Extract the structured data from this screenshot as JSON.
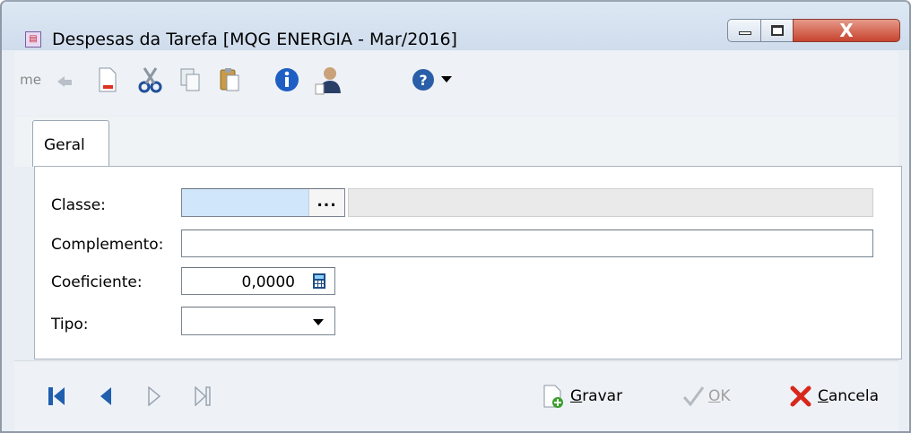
{
  "window": {
    "title": "Despesas da Tarefa [MQG ENERGIA - Mar/2016]",
    "close_glyph": "X"
  },
  "toolbar": {
    "text_fragment": "me",
    "icons": [
      "undo-icon",
      "new-document-icon",
      "cut-icon",
      "copy-icon",
      "paste-icon",
      "info-icon",
      "user-icon",
      "help-icon",
      "dropdown-arrow-icon"
    ]
  },
  "tabs": [
    {
      "label": "Geral",
      "hotkey": "e"
    }
  ],
  "form": {
    "classe": {
      "label": "Classe:",
      "value": "",
      "lookup_label": "...",
      "description": ""
    },
    "complemento": {
      "label": "Complemento:",
      "value": ""
    },
    "coeficiente": {
      "label": "Coeficiente:",
      "value": "0,0000"
    },
    "tipo": {
      "label": "Tipo:",
      "selected": ""
    }
  },
  "navigation": [
    "first-record-icon",
    "previous-record-icon",
    "next-record-icon",
    "last-record-icon"
  ],
  "buttons": {
    "gravar": {
      "hotkey": "G",
      "rest": "ravar",
      "enabled": true
    },
    "ok": {
      "hotkey": "O",
      "rest": "K",
      "enabled": false
    },
    "cancela": {
      "hotkey": "C",
      "rest": "ancela",
      "enabled": true
    }
  },
  "colors": {
    "accent_blue": "#1f5fae",
    "selected_field": "#cfe6fb",
    "close_red": "#c7432e"
  }
}
